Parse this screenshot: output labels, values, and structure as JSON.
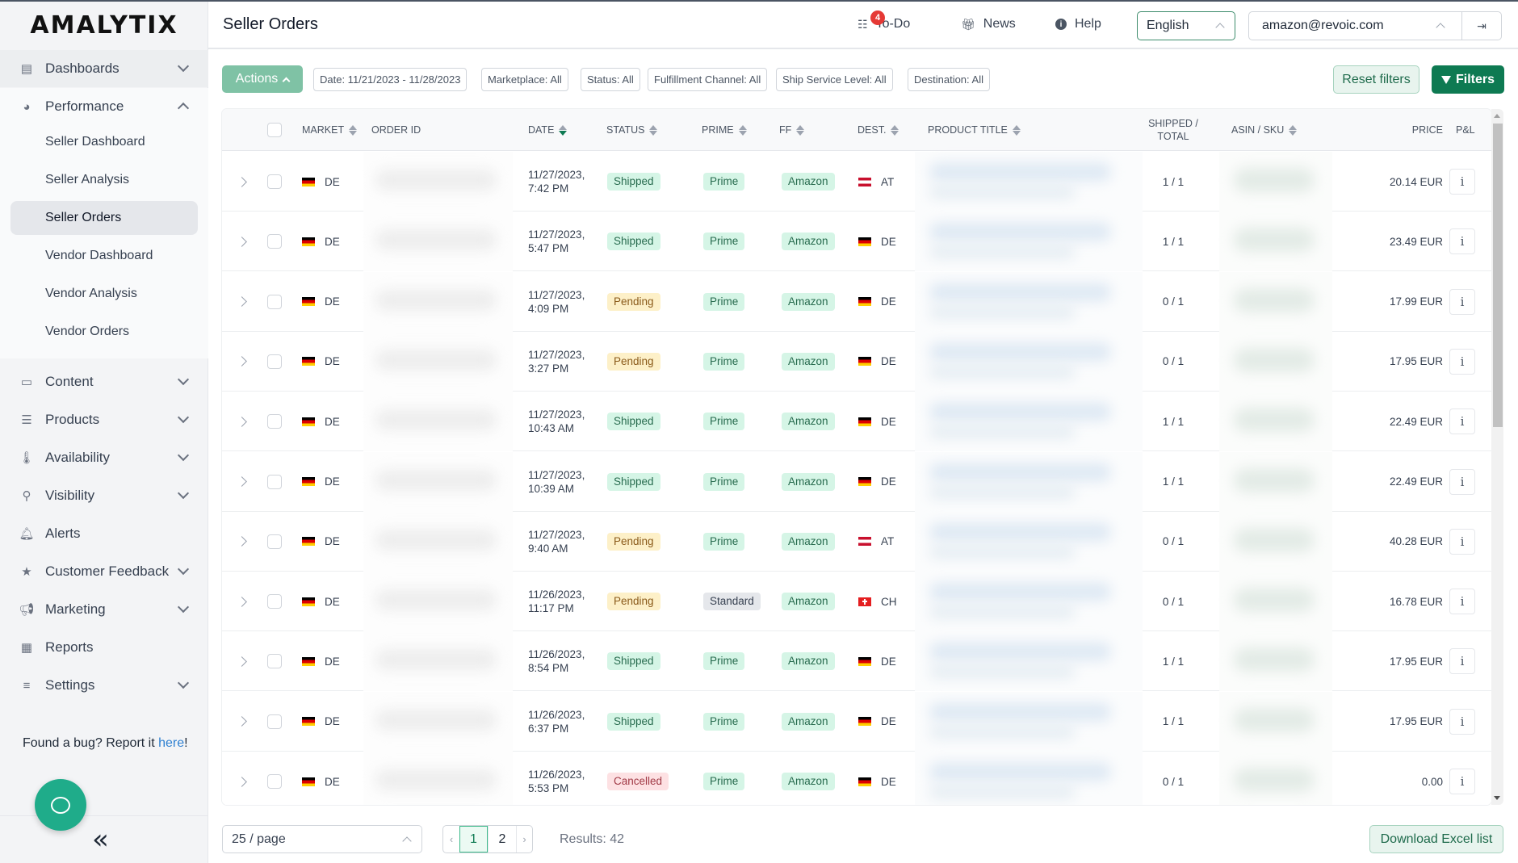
{
  "app": {
    "logo": "AMALYTIX"
  },
  "sidebar": {
    "items": [
      {
        "label": "Dashboards",
        "icon": "server-icon",
        "expandable": true,
        "expanded": false
      },
      {
        "label": "Performance",
        "icon": "gauge-icon",
        "expandable": true,
        "expanded": true
      },
      {
        "label": "Content",
        "icon": "id-card-icon",
        "expandable": true,
        "expanded": false
      },
      {
        "label": "Products",
        "icon": "list-icon",
        "expandable": true,
        "expanded": false
      },
      {
        "label": "Availability",
        "icon": "thermometer-icon",
        "expandable": true,
        "expanded": false
      },
      {
        "label": "Visibility",
        "icon": "search-icon",
        "expandable": true,
        "expanded": false
      },
      {
        "label": "Alerts",
        "icon": "bell-icon",
        "expandable": false
      },
      {
        "label": "Customer Feedback",
        "icon": "star-icon",
        "expandable": true,
        "expanded": false
      },
      {
        "label": "Marketing",
        "icon": "megaphone-icon",
        "expandable": true,
        "expanded": false
      },
      {
        "label": "Reports",
        "icon": "table-icon",
        "expandable": false
      },
      {
        "label": "Settings",
        "icon": "sliders-icon",
        "expandable": true,
        "expanded": false
      }
    ],
    "performance_subitems": [
      {
        "label": "Seller Dashboard",
        "active": false
      },
      {
        "label": "Seller Analysis",
        "active": false
      },
      {
        "label": "Seller Orders",
        "active": true
      },
      {
        "label": "Vendor Dashboard",
        "active": false
      },
      {
        "label": "Vendor Analysis",
        "active": false
      },
      {
        "label": "Vendor Orders",
        "active": false
      }
    ],
    "bug_text": "Found a bug? Report it ",
    "bug_link": "here",
    "bug_suffix": "!",
    "collapse_glyph": "«"
  },
  "header": {
    "title": "Seller Orders",
    "todo_label": "To-Do",
    "todo_count": "4",
    "news_label": "News",
    "help_label": "Help",
    "language": "English",
    "user_email": "amazon@revoic.com"
  },
  "filters": {
    "actions_label": "Actions",
    "chips": [
      "Date: 11/21/2023 - 11/28/2023",
      "Marketplace: All",
      "Status: All",
      "Fulfillment Channel: All",
      "Ship Service Level: All",
      "Destination: All"
    ],
    "reset_label": "Reset filters",
    "filters_label": "Filters"
  },
  "table": {
    "columns": {
      "market": "MARKET",
      "order_id": "ORDER ID",
      "date": "DATE",
      "status": "STATUS",
      "prime": "PRIME",
      "ff": "FF",
      "dest": "DEST.",
      "product_title": "PRODUCT TITLE",
      "shipped_total": "SHIPPED / TOTAL",
      "asin_sku": "ASIN / SKU",
      "price": "PRICE",
      "pl": "P&L"
    },
    "sorted_column": "date",
    "sort_direction": "desc",
    "info_glyph": "i",
    "rows": [
      {
        "market": "DE",
        "date": "11/27/2023,",
        "time": "7:42 PM",
        "status": "Shipped",
        "status_color": "green",
        "prime": "Prime",
        "prime_color": "green",
        "ff": "Amazon",
        "dest_flag": "at",
        "dest": "AT",
        "shipped": "1 / 1",
        "price": "20.14 EUR"
      },
      {
        "market": "DE",
        "date": "11/27/2023,",
        "time": "5:47 PM",
        "status": "Shipped",
        "status_color": "green",
        "prime": "Prime",
        "prime_color": "green",
        "ff": "Amazon",
        "dest_flag": "de",
        "dest": "DE",
        "shipped": "1 / 1",
        "price": "23.49 EUR"
      },
      {
        "market": "DE",
        "date": "11/27/2023,",
        "time": "4:09 PM",
        "status": "Pending",
        "status_color": "yellow",
        "prime": "Prime",
        "prime_color": "green",
        "ff": "Amazon",
        "dest_flag": "de",
        "dest": "DE",
        "shipped": "0 / 1",
        "price": "17.99 EUR"
      },
      {
        "market": "DE",
        "date": "11/27/2023,",
        "time": "3:27 PM",
        "status": "Pending",
        "status_color": "yellow",
        "prime": "Prime",
        "prime_color": "green",
        "ff": "Amazon",
        "dest_flag": "de",
        "dest": "DE",
        "shipped": "0 / 1",
        "price": "17.95 EUR"
      },
      {
        "market": "DE",
        "date": "11/27/2023,",
        "time": "10:43 AM",
        "status": "Shipped",
        "status_color": "green",
        "prime": "Prime",
        "prime_color": "green",
        "ff": "Amazon",
        "dest_flag": "de",
        "dest": "DE",
        "shipped": "1 / 1",
        "price": "22.49 EUR"
      },
      {
        "market": "DE",
        "date": "11/27/2023,",
        "time": "10:39 AM",
        "status": "Shipped",
        "status_color": "green",
        "prime": "Prime",
        "prime_color": "green",
        "ff": "Amazon",
        "dest_flag": "de",
        "dest": "DE",
        "shipped": "1 / 1",
        "price": "22.49 EUR"
      },
      {
        "market": "DE",
        "date": "11/27/2023,",
        "time": "9:40 AM",
        "status": "Pending",
        "status_color": "yellow",
        "prime": "Prime",
        "prime_color": "green",
        "ff": "Amazon",
        "dest_flag": "at",
        "dest": "AT",
        "shipped": "0 / 1",
        "price": "40.28 EUR"
      },
      {
        "market": "DE",
        "date": "11/26/2023,",
        "time": "11:17 PM",
        "status": "Pending",
        "status_color": "yellow",
        "prime": "Standard",
        "prime_color": "gray",
        "ff": "Amazon",
        "dest_flag": "ch",
        "dest": "CH",
        "shipped": "0 / 1",
        "price": "16.78 EUR"
      },
      {
        "market": "DE",
        "date": "11/26/2023,",
        "time": "8:54 PM",
        "status": "Shipped",
        "status_color": "green",
        "prime": "Prime",
        "prime_color": "green",
        "ff": "Amazon",
        "dest_flag": "de",
        "dest": "DE",
        "shipped": "1 / 1",
        "price": "17.95 EUR"
      },
      {
        "market": "DE",
        "date": "11/26/2023,",
        "time": "6:37 PM",
        "status": "Shipped",
        "status_color": "green",
        "prime": "Prime",
        "prime_color": "green",
        "ff": "Amazon",
        "dest_flag": "de",
        "dest": "DE",
        "shipped": "1 / 1",
        "price": "17.95 EUR"
      },
      {
        "market": "DE",
        "date": "11/26/2023,",
        "time": "5:53 PM",
        "status": "Cancelled",
        "status_color": "red",
        "prime": "Prime",
        "prime_color": "green",
        "ff": "Amazon",
        "dest_flag": "de",
        "dest": "DE",
        "shipped": "0 / 1",
        "price": "0.00"
      }
    ]
  },
  "footer": {
    "page_size": "25 / page",
    "pages": [
      "1",
      "2"
    ],
    "current_page": "1",
    "results": "Results: 42",
    "download_label": "Download Excel list"
  }
}
